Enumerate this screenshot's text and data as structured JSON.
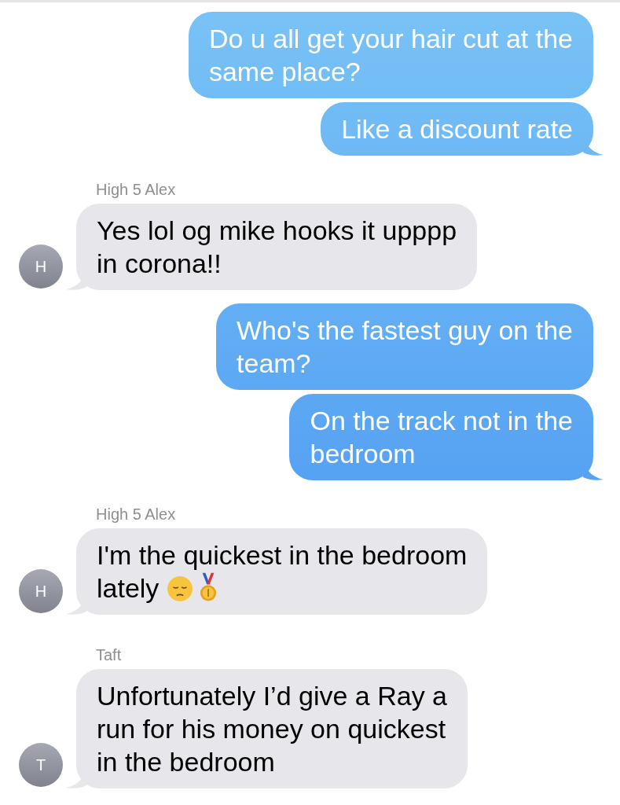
{
  "messages": [
    {
      "kind": "sent",
      "text": "Do u all get your hair cut at the\nsame place?",
      "tail": false
    },
    {
      "kind": "sent",
      "text": "Like a discount rate",
      "tail": true
    },
    {
      "kind": "received",
      "sender": "High 5 Alex",
      "avatar": "H",
      "text": "Yes lol og mike hooks it upppp\nin corona!!",
      "tail": true
    },
    {
      "kind": "sent",
      "text": "Who's the fastest guy on the\nteam?",
      "tail": false
    },
    {
      "kind": "sent",
      "text": "On the track not in the\nbedroom",
      "tail": true
    },
    {
      "kind": "received",
      "sender": "High 5 Alex",
      "avatar": "H",
      "text": "I'm the quickest in the bedroom\nlately",
      "emojis": [
        {
          "kind": "pensive"
        },
        {
          "kind": "medal"
        }
      ],
      "tail": true
    },
    {
      "kind": "received",
      "sender": "Taft",
      "avatar": "T",
      "text": "Unfortunately I’d give a Ray a\nrun for his money on quickest\nin the bedroom",
      "tail": true
    }
  ]
}
